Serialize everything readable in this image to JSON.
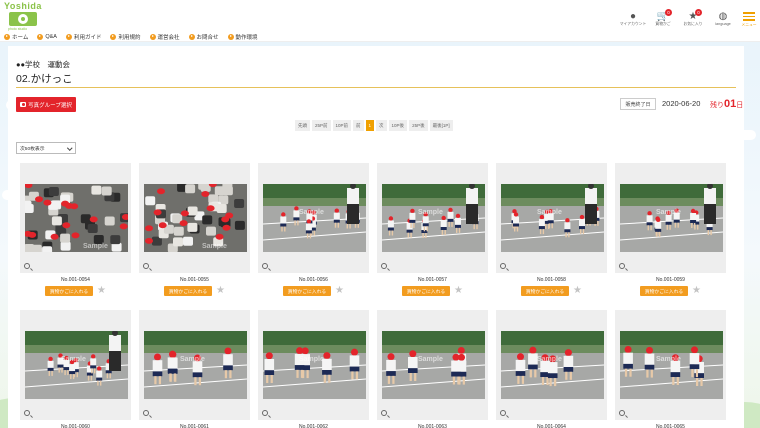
{
  "header": {
    "logo_text": "Yoshida",
    "logo_sub": "photo studio",
    "icons": [
      {
        "name": "user-icon",
        "glyph": "●",
        "label": "マイアカウント",
        "badge": ""
      },
      {
        "name": "cart-icon",
        "glyph": "🛒",
        "label": "買物かご",
        "badge": "0"
      },
      {
        "name": "star-icon",
        "glyph": "★",
        "label": "お気に入り",
        "badge": "0"
      },
      {
        "name": "globe-icon",
        "glyph": "◍",
        "label": "language",
        "badge": ""
      }
    ],
    "menu_label": "メニュー"
  },
  "nav": [
    "ホーム",
    "Q&A",
    "利用ガイド",
    "利用規約",
    "運営会社",
    "お問合せ",
    "動作環境"
  ],
  "page": {
    "school": "●●学校　運動会",
    "event": "02.かけっこ",
    "group_button": "写真グループ選択",
    "sale_end_label": "販売終了日",
    "sale_end_date": "2020-06-20",
    "remain_prefix": "残り",
    "remain_days": "01",
    "remain_suffix": "日",
    "per_page": "次50枚表示"
  },
  "pager": [
    "先頭",
    "25P前",
    "10P前",
    "前",
    "1",
    "次",
    "10P後",
    "25P後",
    "最後[1P]"
  ],
  "pager_current": "1",
  "photos": [
    {
      "no": "No.001-0054",
      "scene": "crowd"
    },
    {
      "no": "No.001-0055",
      "scene": "crowd"
    },
    {
      "no": "No.001-0056",
      "scene": "race"
    },
    {
      "no": "No.001-0057",
      "scene": "race"
    },
    {
      "no": "No.001-0058",
      "scene": "race"
    },
    {
      "no": "No.001-0059",
      "scene": "race"
    },
    {
      "no": "No.001-0060",
      "scene": "race"
    },
    {
      "no": "No.001-0061",
      "scene": "race"
    },
    {
      "no": "No.001-0062",
      "scene": "race"
    },
    {
      "no": "No.001-0063",
      "scene": "race"
    },
    {
      "no": "No.001-0064",
      "scene": "race"
    },
    {
      "no": "No.001-0065",
      "scene": "race"
    }
  ],
  "cart_label": "買物かごに入れる",
  "watermark": "Sample"
}
